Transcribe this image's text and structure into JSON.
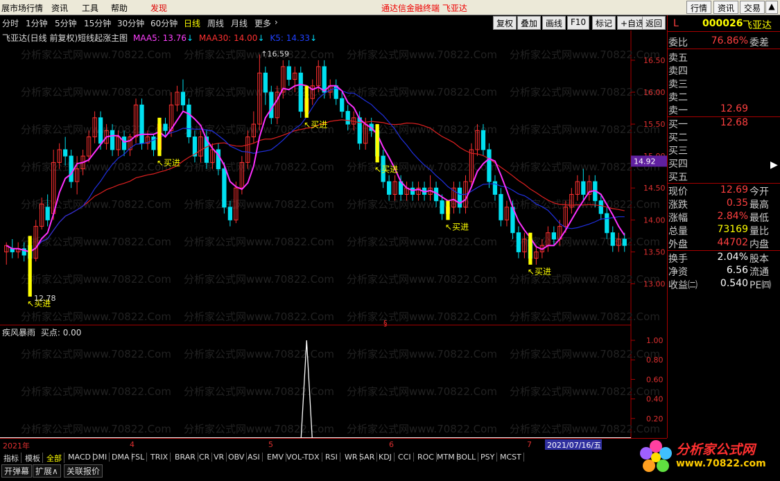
{
  "menu": {
    "items": [
      "展市场行情",
      "资讯",
      "工具",
      "帮助",
      "发现"
    ],
    "center_title": "通达信金融终端   飞亚达",
    "right_buttons": [
      "行情",
      "资讯",
      "交易"
    ]
  },
  "period_tabs": [
    "分时",
    "1分钟",
    "5分钟",
    "15分钟",
    "30分钟",
    "60分钟",
    "日线",
    "周线",
    "月线",
    "更多"
  ],
  "period_selected": "日线",
  "toolbar_buttons": [
    "复权",
    "叠加",
    "画线",
    "F10",
    "标记",
    "+自选",
    "返回"
  ],
  "main_chart": {
    "title": "飞亚达(日线 前复权)短线起涨主图",
    "legend": [
      {
        "label": "MAA5: 13.76",
        "color": "#ff40ff"
      },
      {
        "label": "MAA30: 14.00",
        "color": "#ff3030"
      },
      {
        "label": "K5: 14.33",
        "color": "#2040ff"
      }
    ],
    "high_label": "16.59",
    "low_label": "12.78",
    "price_ticks": [
      "16.50",
      "16.00",
      "15.50",
      "15.00",
      "14.50",
      "14.00",
      "13.50",
      "13.00"
    ],
    "current_price_box": "14.92",
    "buy_label": "买进",
    "watermark": "分析家公式网www.70822.Com"
  },
  "sub_chart": {
    "title": "疾风暴雨",
    "value_label": "买点: 0.00",
    "ticks": [
      "1.00",
      "0.80",
      "0.60",
      "0.40",
      "0.20"
    ]
  },
  "time_axis": {
    "labels": [
      "2021年",
      "4",
      "5",
      "6",
      "7"
    ],
    "cursor_date": "2021/07/16/五"
  },
  "indicator_tabs": [
    "指标",
    "模板",
    "全部",
    "MACD",
    "DMI",
    "DMA",
    "FSL",
    "TRIX",
    "BRAR",
    "CR",
    "VR",
    "OBV",
    "ASI",
    "EMV",
    "VOL-TDX",
    "RSI",
    "WR",
    "SAR",
    "KDJ",
    "CCI",
    "ROC",
    "MTM",
    "BOLL",
    "PSY",
    "MCST"
  ],
  "indicator_selected": "全部",
  "status_buttons": [
    "开弹幕",
    "扩展∧",
    "关联报价"
  ],
  "quote_panel": {
    "market_flag": "L",
    "code": "000026",
    "name": "飞亚达",
    "weibi_label": "委比",
    "weibi_value": "76.86%",
    "weicha_label": "委差",
    "sell_levels": [
      {
        "label": "卖五",
        "value": ""
      },
      {
        "label": "卖四",
        "value": ""
      },
      {
        "label": "卖三",
        "value": ""
      },
      {
        "label": "卖二",
        "value": ""
      },
      {
        "label": "卖一",
        "value": "12.69"
      }
    ],
    "buy_levels": [
      {
        "label": "买一",
        "value": "12.68"
      },
      {
        "label": "买二",
        "value": ""
      },
      {
        "label": "买三",
        "value": ""
      },
      {
        "label": "买四",
        "value": ""
      },
      {
        "label": "买五",
        "value": ""
      }
    ],
    "stats": [
      {
        "label": "现价",
        "value": "12.69",
        "right": "今开",
        "color": "red"
      },
      {
        "label": "涨跌",
        "value": "0.35",
        "right": "最高",
        "color": "red"
      },
      {
        "label": "涨幅",
        "value": "2.84%",
        "right": "最低",
        "color": "red"
      },
      {
        "label": "总量",
        "value": "73169",
        "right": "量比",
        "color": "yellow"
      },
      {
        "label": "外盘",
        "value": "44702",
        "right": "内盘",
        "color": "red"
      },
      {
        "label": "换手",
        "value": "2.04%",
        "right": "股本",
        "color": "white"
      },
      {
        "label": "净资",
        "value": "6.56",
        "right": "流通",
        "color": "white"
      },
      {
        "label": "收益㈡",
        "value": "0.540",
        "right": "PE㈣",
        "color": "white"
      }
    ]
  },
  "logo": {
    "line1": "分析家公式网",
    "line2": "www.70822.com"
  },
  "chart_data": {
    "type": "candlestick",
    "y_axis": {
      "min": 12.78,
      "max": 16.59
    },
    "candles": [
      [
        13.5,
        13.6,
        13.3,
        13.65
      ],
      [
        13.55,
        13.5,
        13.4,
        13.7
      ],
      [
        13.5,
        13.55,
        13.4,
        13.65
      ],
      [
        13.55,
        13.45,
        13.35,
        13.65
      ],
      [
        13.6,
        13.4,
        12.8,
        13.75
      ],
      [
        13.4,
        13.9,
        13.35,
        14.0
      ],
      [
        13.9,
        14.25,
        13.85,
        14.35
      ],
      [
        14.2,
        14.0,
        13.9,
        14.4
      ],
      [
        14.1,
        14.9,
        14.0,
        15.1
      ],
      [
        14.9,
        15.1,
        14.8,
        15.2
      ],
      [
        15.1,
        15.0,
        14.85,
        15.3
      ],
      [
        15.0,
        14.6,
        14.5,
        15.1
      ],
      [
        14.6,
        14.8,
        14.4,
        15.0
      ],
      [
        14.8,
        15.0,
        14.7,
        15.1
      ],
      [
        15.0,
        15.3,
        14.9,
        15.4
      ],
      [
        15.3,
        15.6,
        15.2,
        15.7
      ],
      [
        15.6,
        15.2,
        15.1,
        15.7
      ],
      [
        15.2,
        15.4,
        15.1,
        15.5
      ],
      [
        15.4,
        15.1,
        15.0,
        15.5
      ],
      [
        15.1,
        15.3,
        15.0,
        15.4
      ],
      [
        15.3,
        15.1,
        15.0,
        15.4
      ],
      [
        15.1,
        15.3,
        15.0,
        15.35
      ],
      [
        15.3,
        15.8,
        15.2,
        15.9
      ],
      [
        15.8,
        15.2,
        15.1,
        15.9
      ],
      [
        15.2,
        15.3,
        15.1,
        15.4
      ],
      [
        15.3,
        15.1,
        15.0,
        15.35
      ],
      [
        15.1,
        15.5,
        15.0,
        15.6
      ],
      [
        15.5,
        15.4,
        15.3,
        15.6
      ],
      [
        15.4,
        15.8,
        15.3,
        16.0
      ],
      [
        15.8,
        16.0,
        15.7,
        16.1
      ],
      [
        16.0,
        15.8,
        15.7,
        16.2
      ],
      [
        15.8,
        15.3,
        15.2,
        15.9
      ],
      [
        15.3,
        15.0,
        14.9,
        15.4
      ],
      [
        15.0,
        15.3,
        14.9,
        15.4
      ],
      [
        15.3,
        14.9,
        14.8,
        15.4
      ],
      [
        14.9,
        15.1,
        14.8,
        15.2
      ],
      [
        15.1,
        14.8,
        14.7,
        15.2
      ],
      [
        14.8,
        14.2,
        14.1,
        14.9
      ],
      [
        14.2,
        14.0,
        13.9,
        14.3
      ],
      [
        14.0,
        14.5,
        13.95,
        14.6
      ],
      [
        14.5,
        14.9,
        14.4,
        15.0
      ],
      [
        14.9,
        15.3,
        14.8,
        15.4
      ],
      [
        15.3,
        15.5,
        15.2,
        15.7
      ],
      [
        15.5,
        16.3,
        15.4,
        16.59
      ],
      [
        16.3,
        16.0,
        15.8,
        16.4
      ],
      [
        16.0,
        15.6,
        15.5,
        16.1
      ],
      [
        15.6,
        16.0,
        15.5,
        16.1
      ],
      [
        16.0,
        16.4,
        15.9,
        16.5
      ],
      [
        16.4,
        16.2,
        16.1,
        16.5
      ],
      [
        16.2,
        16.3,
        16.0,
        16.4
      ],
      [
        16.3,
        15.7,
        15.6,
        16.4
      ],
      [
        15.7,
        15.9,
        15.6,
        16.1
      ],
      [
        15.9,
        16.1,
        15.8,
        16.2
      ],
      [
        16.1,
        16.4,
        16.0,
        16.5
      ],
      [
        16.4,
        16.0,
        15.9,
        16.5
      ],
      [
        16.0,
        16.1,
        15.9,
        16.2
      ],
      [
        16.1,
        15.9,
        15.8,
        16.2
      ],
      [
        15.9,
        15.7,
        15.6,
        16.0
      ],
      [
        15.7,
        15.5,
        15.4,
        15.8
      ],
      [
        15.5,
        15.6,
        15.4,
        15.7
      ],
      [
        15.6,
        15.2,
        15.1,
        15.7
      ],
      [
        15.2,
        15.5,
        15.1,
        15.6
      ],
      [
        15.5,
        15.4,
        15.3,
        15.6
      ],
      [
        15.4,
        15.0,
        14.9,
        15.5
      ],
      [
        15.0,
        14.6,
        14.5,
        15.1
      ],
      [
        14.6,
        14.4,
        14.3,
        14.7
      ],
      [
        14.4,
        14.6,
        14.3,
        14.7
      ],
      [
        14.6,
        14.4,
        14.3,
        14.7
      ],
      [
        14.4,
        14.5,
        14.3,
        14.6
      ],
      [
        14.5,
        14.4,
        14.3,
        14.6
      ],
      [
        14.4,
        14.5,
        14.3,
        14.6
      ],
      [
        14.5,
        14.4,
        14.3,
        14.6
      ],
      [
        14.4,
        14.5,
        14.3,
        14.7
      ],
      [
        14.5,
        14.3,
        14.2,
        14.6
      ],
      [
        14.3,
        14.1,
        14.0,
        14.4
      ],
      [
        14.1,
        14.2,
        14.0,
        14.3
      ],
      [
        14.2,
        14.5,
        14.1,
        14.6
      ],
      [
        14.5,
        14.2,
        14.1,
        14.6
      ],
      [
        14.2,
        14.6,
        14.1,
        14.7
      ],
      [
        14.6,
        15.1,
        14.5,
        15.2
      ],
      [
        15.1,
        15.4,
        15.0,
        15.5
      ],
      [
        15.4,
        15.1,
        15.0,
        15.5
      ],
      [
        15.1,
        14.6,
        14.5,
        15.2
      ],
      [
        14.6,
        14.4,
        14.3,
        14.7
      ],
      [
        14.4,
        14.0,
        13.9,
        14.5
      ],
      [
        14.0,
        14.2,
        13.9,
        14.3
      ],
      [
        14.2,
        13.8,
        13.7,
        14.3
      ],
      [
        13.8,
        13.5,
        13.4,
        13.9
      ],
      [
        13.5,
        13.7,
        13.4,
        13.8
      ],
      [
        13.7,
        13.4,
        13.3,
        13.8
      ],
      [
        13.4,
        13.5,
        13.3,
        13.6
      ],
      [
        13.5,
        13.6,
        13.4,
        13.7
      ],
      [
        13.6,
        13.8,
        13.5,
        13.9
      ],
      [
        13.8,
        13.7,
        13.6,
        13.9
      ],
      [
        13.7,
        13.9,
        13.6,
        14.0
      ],
      [
        13.9,
        14.2,
        13.8,
        14.3
      ],
      [
        14.2,
        14.4,
        14.1,
        14.5
      ],
      [
        14.4,
        14.6,
        14.3,
        14.7
      ],
      [
        14.6,
        14.4,
        14.3,
        14.8
      ],
      [
        14.4,
        14.6,
        14.3,
        14.7
      ],
      [
        14.6,
        14.3,
        14.2,
        14.7
      ],
      [
        14.3,
        14.1,
        14.0,
        14.4
      ],
      [
        14.1,
        13.8,
        13.7,
        14.2
      ],
      [
        13.8,
        13.6,
        13.5,
        13.9
      ],
      [
        13.6,
        13.7,
        13.5,
        13.8
      ],
      [
        13.7,
        13.6,
        13.5,
        13.8
      ]
    ]
  }
}
